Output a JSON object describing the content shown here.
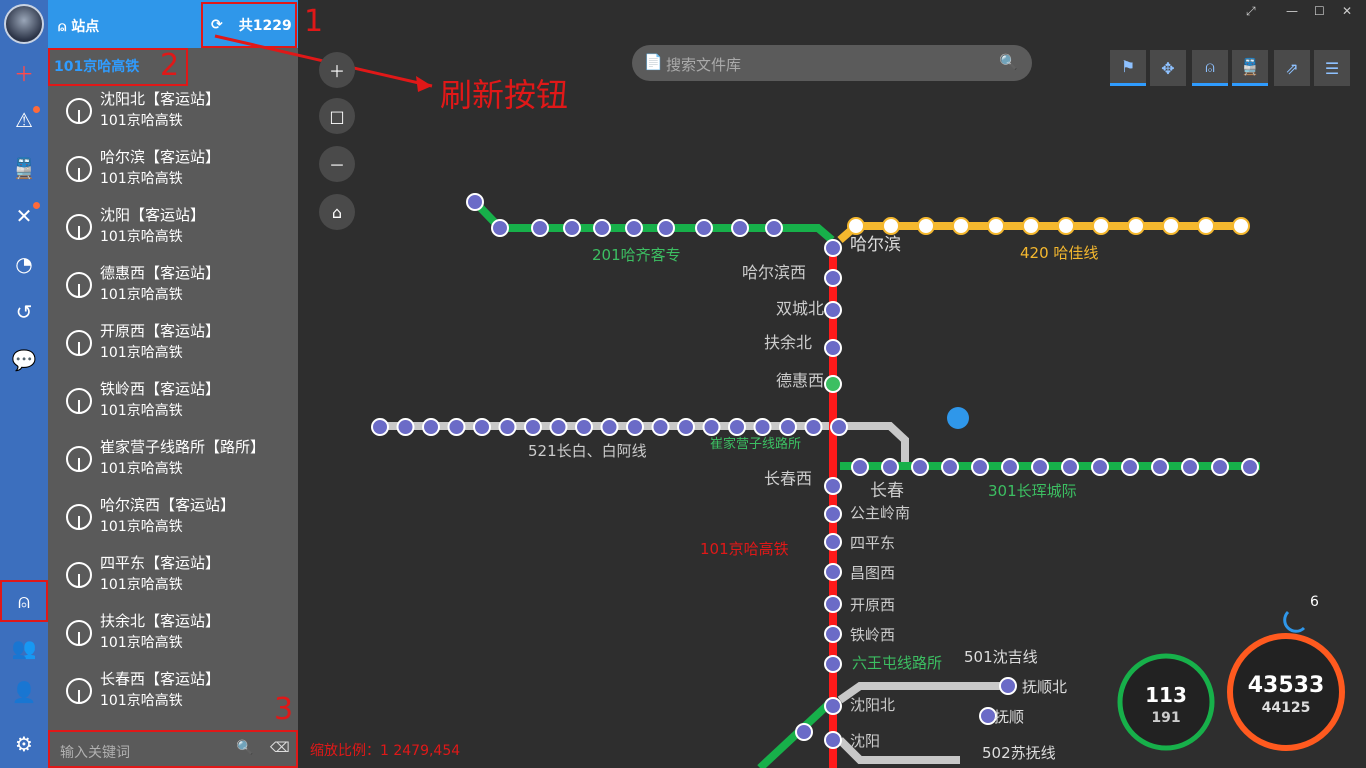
{
  "sidebar": {
    "header_title": "站点",
    "total": "共1229",
    "line_tab": "101京哈高铁",
    "stations": [
      {
        "name": "沈阳北【客运站】",
        "line": "101京哈高铁"
      },
      {
        "name": "哈尔滨【客运站】",
        "line": "101京哈高铁"
      },
      {
        "name": "沈阳【客运站】",
        "line": "101京哈高铁"
      },
      {
        "name": "德惠西【客运站】",
        "line": "101京哈高铁"
      },
      {
        "name": "开原西【客运站】",
        "line": "101京哈高铁"
      },
      {
        "name": "铁岭西【客运站】",
        "line": "101京哈高铁"
      },
      {
        "name": "崔家营子线路所【路所】",
        "line": "101京哈高铁"
      },
      {
        "name": "哈尔滨西【客运站】",
        "line": "101京哈高铁"
      },
      {
        "name": "四平东【客运站】",
        "line": "101京哈高铁"
      },
      {
        "name": "扶余北【客运站】",
        "line": "101京哈高铁"
      },
      {
        "name": "长春西【客运站】",
        "line": "101京哈高铁"
      }
    ],
    "keyword_placeholder": "输入关键词"
  },
  "annotations": {
    "n1": "1",
    "n2": "2",
    "n3": "3",
    "refresh_label": "刷新按钮"
  },
  "search": {
    "placeholder": "搜索文件库"
  },
  "scale_text": "缩放比例：1 2479,454",
  "map": {
    "lines": {
      "l201": "201哈齐客专",
      "l420": "420 哈佳线",
      "l521": "521长白、白阿线",
      "l301": "301长珲城际",
      "l101": "101京哈高铁",
      "l501": "501沈吉线",
      "l502": "502苏抚线"
    },
    "stations_101": [
      "哈尔滨西",
      "双城北",
      "扶余北",
      "德惠西",
      "长春西",
      "公主岭南",
      "四平东",
      "昌图西",
      "开原西",
      "铁岭西",
      "六王屯线路所",
      "沈阳北",
      "沈阳"
    ],
    "hub_harbin": "哈尔滨",
    "hub_changchun": "长春",
    "cui_label": "崔家营子线路所",
    "fushun": [
      "抚顺北",
      "抚顺"
    ]
  },
  "gauges": {
    "left_main": "113",
    "left_sub": "191",
    "right_main": "43533",
    "right_sub": "44125",
    "badge": "6"
  },
  "colors": {
    "accent": "#2f97ea",
    "red": "#e01818",
    "line101": "#ff1a1a",
    "line201": "#17b04a",
    "line420": "#f5b82e",
    "line_gray": "#c8c8c8"
  }
}
